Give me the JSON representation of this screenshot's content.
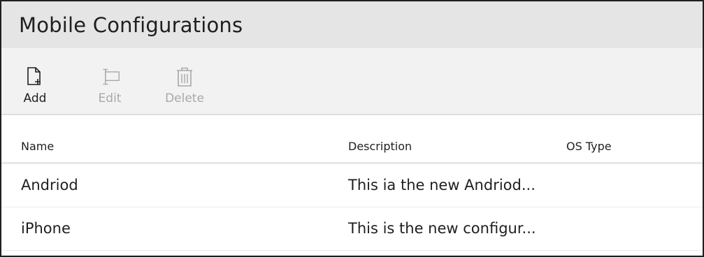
{
  "header": {
    "title": "Mobile Configurations"
  },
  "toolbar": {
    "add": {
      "label": "Add",
      "icon": "new-document-icon",
      "enabled": true
    },
    "edit": {
      "label": "Edit",
      "icon": "edit-icon",
      "enabled": false
    },
    "delete": {
      "label": "Delete",
      "icon": "trash-icon",
      "enabled": false
    }
  },
  "table": {
    "columns": [
      "Name",
      "Description",
      "OS Type"
    ],
    "rows": [
      {
        "name": "Andriod",
        "description": "This ia the new Andriod...",
        "os_type": ""
      },
      {
        "name": "iPhone",
        "description": "This is the new configur...",
        "os_type": ""
      }
    ]
  },
  "colors": {
    "title_bar_bg": "#e5e5e5",
    "toolbar_bg": "#f2f2f2",
    "disabled_text": "#a8a8a8",
    "text": "#1f1f1f"
  }
}
